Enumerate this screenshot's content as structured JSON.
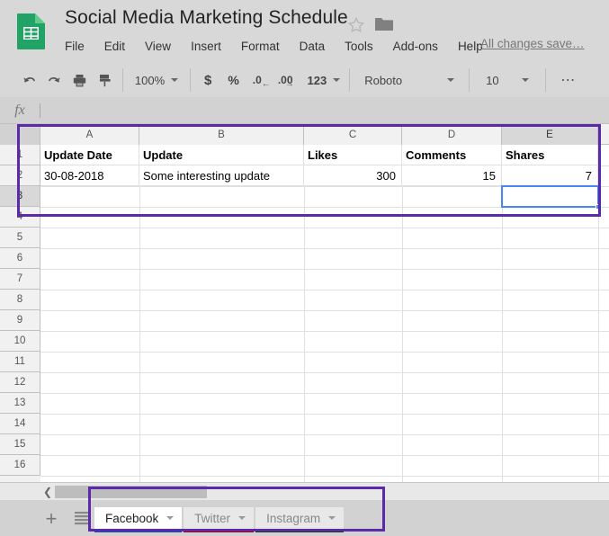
{
  "header": {
    "title": "Social Media Marketing Schedule",
    "logo_icon": "google-sheets-logo",
    "star_icon": "star-outline-icon",
    "folder_icon": "folder-icon",
    "menu": [
      {
        "label": "File"
      },
      {
        "label": "Edit"
      },
      {
        "label": "View"
      },
      {
        "label": "Insert"
      },
      {
        "label": "Format"
      },
      {
        "label": "Data"
      },
      {
        "label": "Tools"
      },
      {
        "label": "Add-ons"
      },
      {
        "label": "Help"
      }
    ],
    "save_status": "All changes save…"
  },
  "toolbar": {
    "undo_icon": "undo-icon",
    "redo_icon": "redo-icon",
    "print_icon": "print-icon",
    "paint_format_icon": "paint-format-icon",
    "zoom_value": "100%",
    "currency_label": "$",
    "percent_label": "%",
    "decrease_decimal_label": ".0",
    "increase_decimal_label": ".00",
    "more_formats_label": "123",
    "font_family": "Roboto",
    "font_size": "10",
    "more_label": "⋯"
  },
  "formula_bar": {
    "fx_label": "fx",
    "value": "",
    "placeholder": ""
  },
  "grid": {
    "columns": [
      "A",
      "B",
      "C",
      "D",
      "E"
    ],
    "active_column": "E",
    "rows": [
      "1",
      "2",
      "3",
      "4",
      "5",
      "6",
      "7",
      "8",
      "9",
      "10",
      "11",
      "12",
      "13",
      "14",
      "15",
      "16"
    ],
    "active_row": "3",
    "active_cell": "E3",
    "data": [
      [
        "Update Date",
        "Update",
        "Likes",
        "Comments",
        "Shares"
      ],
      [
        "30-08-2018",
        "Some interesting update",
        "300",
        "15",
        "7"
      ]
    ],
    "header_row_bold": true,
    "numeric_columns": [
      "C",
      "D",
      "E"
    ],
    "selection_range": "A1:E3",
    "annotation_color": "#5b2aa8",
    "active_cell_color": "#4688f1"
  },
  "scrollbar": {
    "left_arrow_icon": "chevron-left-icon"
  },
  "sheetbar": {
    "add_sheet_label": "+",
    "all_sheets_icon": "all-sheets-icon",
    "tabs": [
      {
        "label": "Facebook",
        "color": "#1155a3",
        "active": true
      },
      {
        "label": "Twitter",
        "color": "#b20000",
        "active": false
      },
      {
        "label": "Instagram",
        "color": "#13420f",
        "active": false
      }
    ]
  }
}
